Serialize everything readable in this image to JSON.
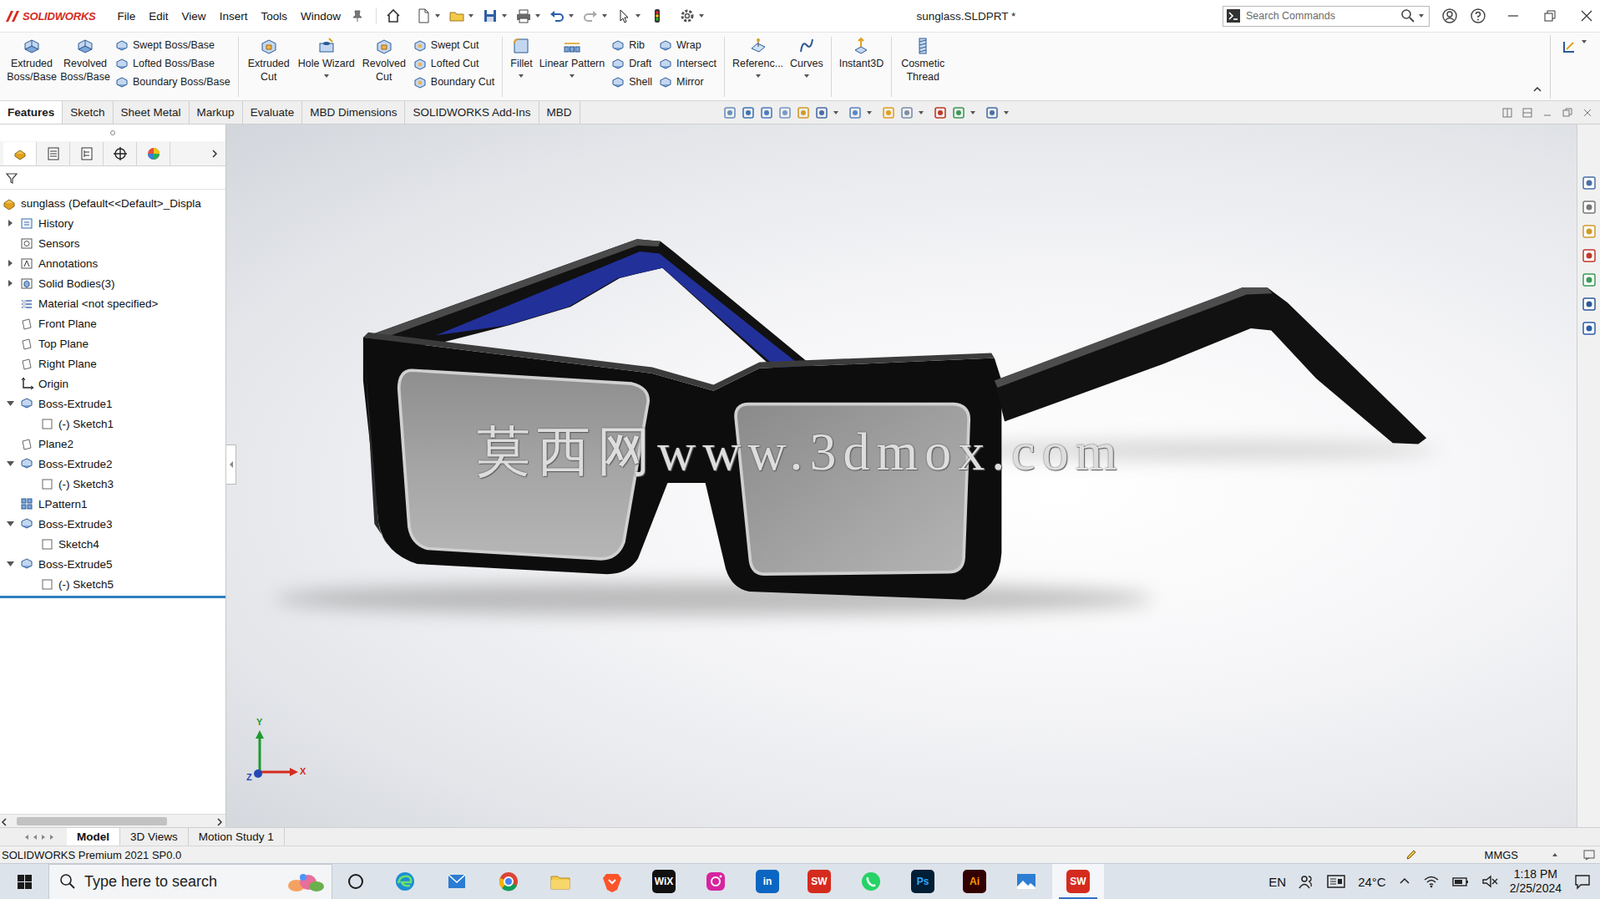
{
  "app": {
    "logo": "SOLIDWORKS",
    "title": "sunglass.SLDPRT *",
    "menu": [
      "File",
      "Edit",
      "View",
      "Insert",
      "Tools",
      "Window"
    ],
    "search": {
      "placeholder": "Search Commands"
    }
  },
  "ribbon": [
    {
      "kind": "big",
      "label": "Extruded Boss/Base",
      "dropdown": false
    },
    {
      "kind": "big",
      "label": "Revolved Boss/Base",
      "dropdown": false
    },
    {
      "kind": "stack",
      "items": [
        "Swept Boss/Base",
        "Lofted Boss/Base",
        "Boundary Boss/Base"
      ]
    },
    {
      "kind": "big",
      "label": "Extruded Cut",
      "dropdown": false
    },
    {
      "kind": "big",
      "label": "Hole Wizard",
      "dropdown": true
    },
    {
      "kind": "big",
      "label": "Revolved Cut",
      "dropdown": false
    },
    {
      "kind": "stack",
      "items": [
        "Swept Cut",
        "Lofted Cut",
        "Boundary Cut"
      ]
    },
    {
      "kind": "big",
      "label": "Fillet",
      "dropdown": true
    },
    {
      "kind": "big",
      "label": "Linear Pattern",
      "dropdown": true
    },
    {
      "kind": "stack",
      "items": [
        "Rib",
        "Draft",
        "Shell"
      ]
    },
    {
      "kind": "stack",
      "items": [
        "Wrap",
        "Intersect",
        "Mirror"
      ]
    },
    {
      "kind": "big",
      "label": "Referenc...",
      "dropdown": true
    },
    {
      "kind": "big",
      "label": "Curves",
      "dropdown": true
    },
    {
      "kind": "big",
      "label": "Instant3D",
      "dropdown": false
    },
    {
      "kind": "big",
      "label": "Cosmetic Thread",
      "dropdown": false
    }
  ],
  "command_tabs": [
    {
      "label": "Features",
      "selected": true
    },
    {
      "label": "Sketch",
      "selected": false
    },
    {
      "label": "Sheet Metal",
      "selected": false
    },
    {
      "label": "Markup",
      "selected": false
    },
    {
      "label": "Evaluate",
      "selected": false
    },
    {
      "label": "MBD Dimensions",
      "selected": false
    },
    {
      "label": "SOLIDWORKS Add-Ins",
      "selected": false
    },
    {
      "label": "MBD",
      "selected": false
    }
  ],
  "feature_tree": {
    "items": [
      {
        "label": "sunglass (Default<<Default>_Displa",
        "depth": 0,
        "expander": "none",
        "kind": "part"
      },
      {
        "label": "History",
        "depth": 1,
        "expander": "collapsed",
        "kind": "history"
      },
      {
        "label": "Sensors",
        "depth": 1,
        "expander": "none",
        "kind": "sensor"
      },
      {
        "label": "Annotations",
        "depth": 1,
        "expander": "collapsed",
        "kind": "annotation"
      },
      {
        "label": "Solid Bodies(3)",
        "depth": 1,
        "expander": "collapsed",
        "kind": "bodies"
      },
      {
        "label": "Material <not specified>",
        "depth": 1,
        "expander": "none",
        "kind": "material"
      },
      {
        "label": "Front Plane",
        "depth": 1,
        "expander": "none",
        "kind": "plane"
      },
      {
        "label": "Top Plane",
        "depth": 1,
        "expander": "none",
        "kind": "plane"
      },
      {
        "label": "Right Plane",
        "depth": 1,
        "expander": "none",
        "kind": "plane"
      },
      {
        "label": "Origin",
        "depth": 1,
        "expander": "none",
        "kind": "origin"
      },
      {
        "label": "Boss-Extrude1",
        "depth": 1,
        "expander": "expanded",
        "kind": "feature"
      },
      {
        "label": "(-) Sketch1",
        "depth": 2,
        "expander": "none",
        "kind": "sketch"
      },
      {
        "label": "Plane2",
        "depth": 1,
        "expander": "none",
        "kind": "plane"
      },
      {
        "label": "Boss-Extrude2",
        "depth": 1,
        "expander": "expanded",
        "kind": "feature"
      },
      {
        "label": "(-) Sketch3",
        "depth": 2,
        "expander": "none",
        "kind": "sketch"
      },
      {
        "label": "LPattern1",
        "depth": 1,
        "expander": "none",
        "kind": "pattern"
      },
      {
        "label": "Boss-Extrude3",
        "depth": 1,
        "expander": "expanded",
        "kind": "feature"
      },
      {
        "label": "Sketch4",
        "depth": 2,
        "expander": "none",
        "kind": "sketch"
      },
      {
        "label": "Boss-Extrude5",
        "depth": 1,
        "expander": "expanded",
        "kind": "feature"
      },
      {
        "label": "(-) Sketch5",
        "depth": 2,
        "expander": "none",
        "kind": "sketch"
      }
    ]
  },
  "viewport": {
    "watermark": "莫西网www.3dmox.com",
    "triad": [
      "Y",
      "X",
      "Z"
    ]
  },
  "bottom_tabs": [
    {
      "label": "Model",
      "selected": true
    },
    {
      "label": "3D Views",
      "selected": false
    },
    {
      "label": "Motion Study 1",
      "selected": false
    }
  ],
  "status_bar": {
    "product": "SOLIDWORKS Premium 2021 SP0.0",
    "units": "MMGS"
  },
  "taskbar": {
    "search_placeholder": "Type here to search",
    "apps": [
      {
        "kind": "edge",
        "active": false
      },
      {
        "kind": "mail",
        "active": false
      },
      {
        "kind": "chrome",
        "active": false
      },
      {
        "kind": "files",
        "active": false
      },
      {
        "kind": "brave",
        "active": false
      },
      {
        "kind": "wix",
        "label": "WiX",
        "active": false
      },
      {
        "kind": "instagram",
        "active": false
      },
      {
        "kind": "linkedin",
        "label": "in",
        "active": false
      },
      {
        "kind": "solidworks",
        "label": "SW",
        "active": false
      },
      {
        "kind": "whatsapp",
        "active": false
      },
      {
        "kind": "photoshop",
        "label": "Ps",
        "active": false
      },
      {
        "kind": "illustrator",
        "label": "Ai",
        "active": false
      },
      {
        "kind": "photos",
        "active": false
      },
      {
        "kind": "solidworks",
        "label": "SW",
        "active": true
      }
    ],
    "language": "EN",
    "temperature": "24°C",
    "time": "1:18 PM",
    "date": "2/25/2024"
  }
}
